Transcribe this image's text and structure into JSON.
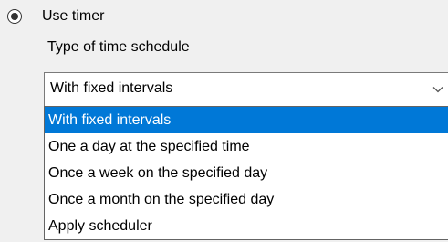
{
  "timer_option": {
    "label": "Use timer",
    "checked": true
  },
  "schedule_type": {
    "label": "Type of time schedule",
    "selected_value": "With fixed intervals",
    "arrow_icon": "chevron-down-icon",
    "options": [
      {
        "label": "With fixed intervals",
        "highlighted": true
      },
      {
        "label": "One a day at the specified time",
        "highlighted": false
      },
      {
        "label": "Once a week on the specified day",
        "highlighted": false
      },
      {
        "label": "Once a month on the specified day",
        "highlighted": false
      },
      {
        "label": "Apply scheduler",
        "highlighted": false
      }
    ]
  },
  "colors": {
    "background": "#f0f0f0",
    "highlight": "#0078d7"
  }
}
